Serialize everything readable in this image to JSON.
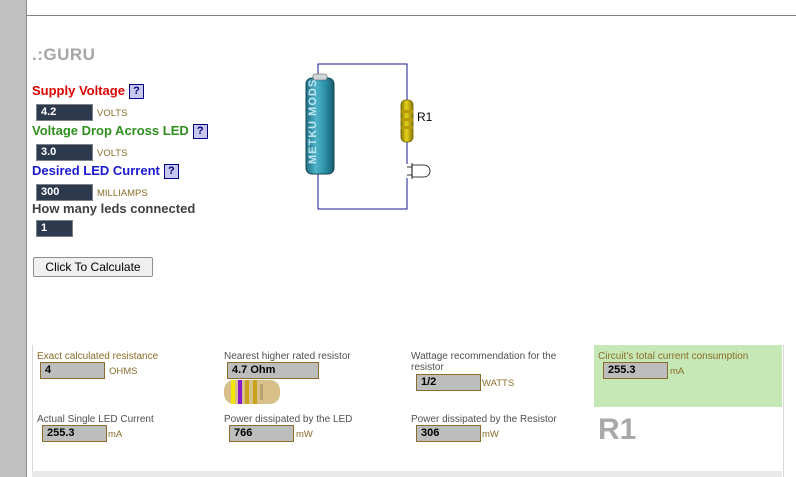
{
  "logo": ".:GURU",
  "form": {
    "supply": {
      "label": "Supply Voltage",
      "value": "4.2",
      "unit": "VOLTS"
    },
    "drop": {
      "label": "Voltage Drop Across LED",
      "value": "3.0",
      "unit": "VOLTS"
    },
    "current": {
      "label": "Desired LED Current",
      "value": "300",
      "unit": "MILLIAMPS"
    },
    "count": {
      "label": "How many leds connected",
      "value": "1"
    },
    "help_glyph": "?",
    "calculate_label": "Click To Calculate"
  },
  "circuit": {
    "battery_text": "METKU MODS",
    "resistor_label": "R1"
  },
  "results": {
    "exact": {
      "label": "Exact calculated resistance",
      "value": "4",
      "unit": "OHMS"
    },
    "nearest": {
      "label": "Nearest higher rated resistor",
      "value": "4.7 Ohm"
    },
    "wattage": {
      "label": "Wattage recommendation for the resistor",
      "value": "1/2",
      "unit": "WATTS"
    },
    "total": {
      "label": "Circuit's total current consumption",
      "value": "255.3",
      "unit": "mA"
    },
    "single": {
      "label": "Actual Single LED Current",
      "value": "255.3",
      "unit": "mA"
    },
    "led_power": {
      "label": "Power dissipated by the LED",
      "value": "766",
      "unit": "mW"
    },
    "res_power": {
      "label": "Power dissipated by the Resistor",
      "value": "306",
      "unit": "mW"
    },
    "r1_big": "R1"
  },
  "colors": {
    "supply_label": "#dd0000",
    "drop_label": "#2f8f1f",
    "current_label": "#1a1ad0",
    "count_label": "#404040",
    "highlight": "#c6e8b7"
  }
}
